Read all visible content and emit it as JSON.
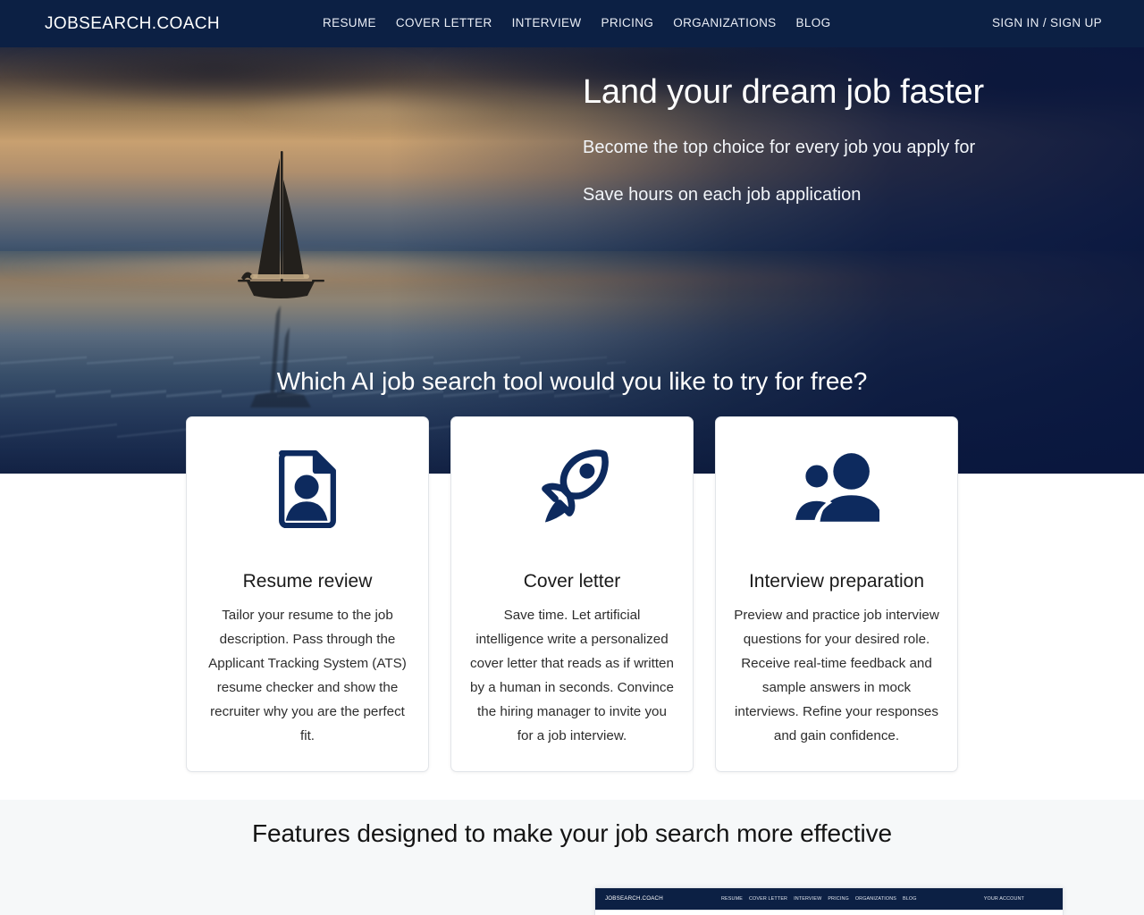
{
  "header": {
    "brand": "JOBSEARCH.COACH",
    "nav": [
      {
        "label": "RESUME",
        "name": "nav-resume"
      },
      {
        "label": "COVER LETTER",
        "name": "nav-cover-letter"
      },
      {
        "label": "INTERVIEW",
        "name": "nav-interview"
      },
      {
        "label": "PRICING",
        "name": "nav-pricing"
      },
      {
        "label": "ORGANIZATIONS",
        "name": "nav-organizations"
      },
      {
        "label": "BLOG",
        "name": "nav-blog"
      }
    ],
    "auth": "SIGN IN / SIGN UP",
    "background_color": "#0c2044",
    "text_color": "#ffffff"
  },
  "hero": {
    "title": "Land your dream job faster",
    "subtitle_1": "Become the top choice for every job you apply for",
    "subtitle_2": "Save hours on each job application",
    "question": "Which AI job search tool would you like to try for free?",
    "image_alt": "sailboat-at-sunset-photo"
  },
  "cards": [
    {
      "icon": "resume-document-person-icon",
      "title": "Resume review",
      "text": "Tailor your resume to the job description. Pass through the Applicant Tracking System (ATS) resume checker and show the recruiter why you are the perfect fit."
    },
    {
      "icon": "rocket-icon",
      "title": "Cover letter",
      "text": "Save time. Let artificial intelligence write a personalized cover letter that reads as if written by a human in seconds. Convince the hiring manager to invite you for a job interview."
    },
    {
      "icon": "people-group-icon",
      "title": "Interview preparation",
      "text": "Preview and practice job interview questions for your desired role. Receive real-time feedback and sample answers in mock interviews. Refine your responses and gain confidence."
    }
  ],
  "features": {
    "title": "Features designed to make your job search more effective",
    "background_color": "#f6f8f9",
    "preview": {
      "brand": "JOBSEARCH.COACH",
      "nav": [
        "RESUME",
        "COVER LETTER",
        "INTERVIEW",
        "PRICING",
        "ORGANIZATIONS",
        "BLOG"
      ],
      "account": "YOUR ACCOUNT"
    }
  },
  "theme": {
    "navy": "#0c2044",
    "icon_navy": "#0d2a5e",
    "card_bg": "#ffffff",
    "card_border": "#e2e5e9"
  }
}
